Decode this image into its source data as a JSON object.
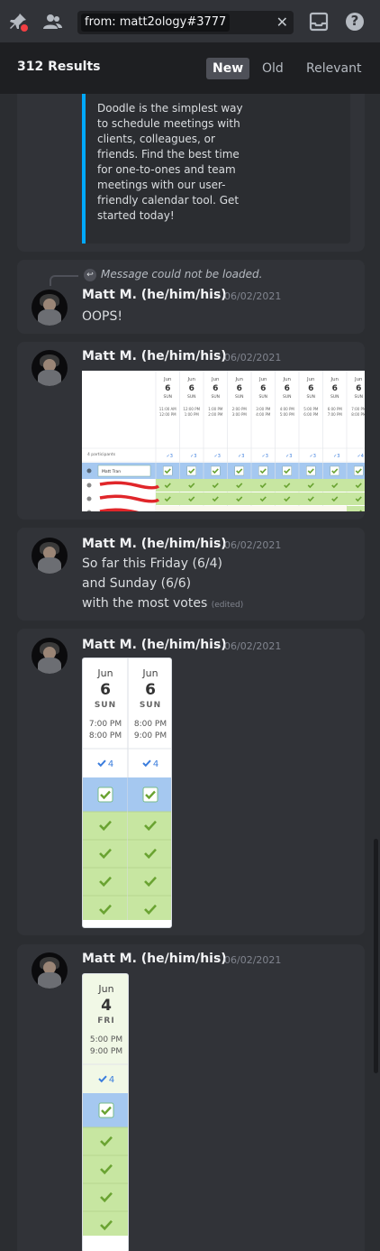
{
  "toolbar": {
    "pin_icon": "pin-icon",
    "members_icon": "members-icon",
    "search_query": "from: matt2ology#3777",
    "clear_label": "✕",
    "inbox_icon": "inbox-icon",
    "help_label": "?"
  },
  "results": {
    "count_label": "312 Results",
    "sort_tabs": [
      "New",
      "Old",
      "Relevant"
    ],
    "active_sort": "New"
  },
  "embed": {
    "description": "Doodle is the simplest way to schedule meetings with clients, colleagues, or friends. Find the best time for one-to-ones and team meetings with our user-friendly calendar tool. Get started today!",
    "accent_color": "#00a8fc"
  },
  "messages": [
    {
      "reply_text": "Message could not be loaded.",
      "author": "Matt M. (he/him/his)",
      "timestamp": "06/02/2021",
      "text": "OOPS!"
    },
    {
      "author": "Matt M. (he/him/his)",
      "timestamp": "06/02/2021",
      "poll": {
        "month": "Jun",
        "day": "6",
        "weekday": "SUN",
        "slots": [
          [
            "11:00 AM",
            "12:00 PM"
          ],
          [
            "12:00 PM",
            "1:00 PM"
          ],
          [
            "1:00 PM",
            "2:00 PM"
          ],
          [
            "2:00 PM",
            "3:00 PM"
          ],
          [
            "3:00 PM",
            "4:00 PM"
          ],
          [
            "4:00 PM",
            "5:00 PM"
          ],
          [
            "5:00 PM",
            "6:00 PM"
          ],
          [
            "6:00 PM",
            "7:00 PM"
          ],
          [
            "7:00 PM",
            "8:00 PM"
          ]
        ],
        "counts": [
          "3",
          "3",
          "3",
          "3",
          "3",
          "3",
          "3",
          "3",
          "4"
        ],
        "participants_label": "4 participants",
        "user_name": "Matt Tran"
      }
    },
    {
      "author": "Matt M. (he/him/his)",
      "timestamp": "06/02/2021",
      "lines": [
        "So far this Friday (6/4)",
        "and Sunday (6/6)",
        "with the most votes"
      ],
      "edited_label": "(edited)"
    },
    {
      "author": "Matt M. (he/him/his)",
      "timestamp": "06/02/2021",
      "columns": [
        {
          "month": "Jun",
          "day": "6",
          "weekday": "SUN",
          "start": "7:00 PM",
          "end": "8:00 PM",
          "count": "4"
        },
        {
          "month": "Jun",
          "day": "6",
          "weekday": "SUN",
          "start": "8:00 PM",
          "end": "9:00 PM",
          "count": "4"
        }
      ]
    },
    {
      "author": "Matt M. (he/him/his)",
      "timestamp": "06/02/2021",
      "columns": [
        {
          "month": "Jun",
          "day": "4",
          "weekday": "FRI",
          "start": "5:00 PM",
          "end": "9:00 PM",
          "count": "4"
        }
      ]
    }
  ],
  "colors": {
    "background": "#2b2d31",
    "card": "#313338",
    "yes_green": "#c7e6a1",
    "own_blue": "#a5c8f0",
    "check_green": "#6aa332",
    "count_blue": "#3b7ddd",
    "redaction_red": "#e0262a"
  }
}
